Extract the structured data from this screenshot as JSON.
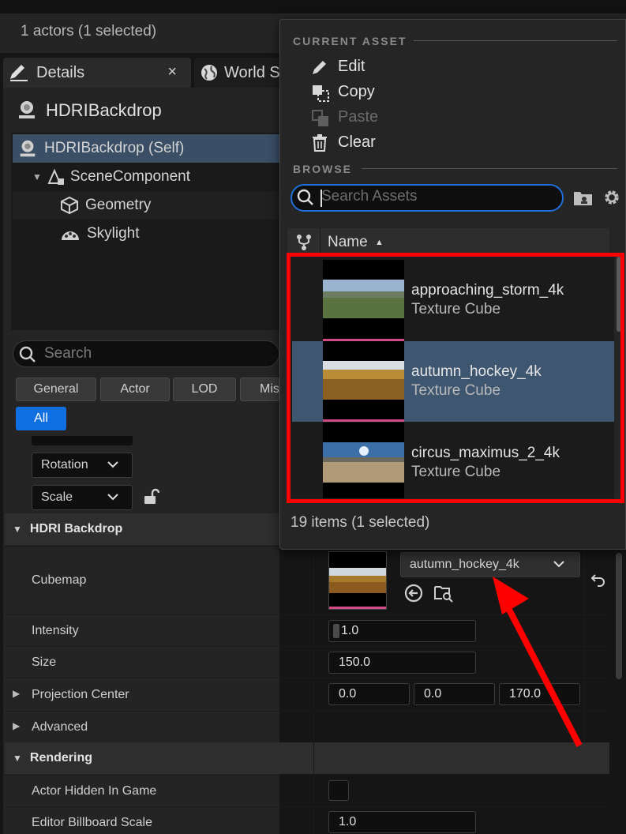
{
  "header": {
    "actors_status": "1 actors (1 selected)"
  },
  "tabs": [
    {
      "label": "Details",
      "close": "×"
    },
    {
      "label": "World S"
    }
  ],
  "actor": {
    "name": "HDRIBackdrop"
  },
  "components": [
    {
      "label": "HDRIBackdrop (Self)"
    },
    {
      "label": "SceneComponent"
    },
    {
      "label": "Geometry"
    },
    {
      "label": "Skylight"
    }
  ],
  "details_search": {
    "placeholder": "Search"
  },
  "filters": [
    "General",
    "Actor",
    "LOD",
    "Mis",
    "All"
  ],
  "transform": {
    "rotation_label": "Rotation",
    "scale_label": "Scale"
  },
  "sections": {
    "hdri_backdrop": "HDRI Backdrop",
    "rendering": "Rendering"
  },
  "properties": {
    "cubemap_label": "Cubemap",
    "cubemap_value": "autumn_hockey_4k",
    "intensity_label": "Intensity",
    "intensity_value": "1.0",
    "size_label": "Size",
    "size_value": "150.0",
    "projection_center_label": "Projection Center",
    "projection_center_values": [
      "0.0",
      "0.0",
      "170.0"
    ],
    "advanced_label": "Advanced",
    "actor_hidden_label": "Actor Hidden In Game",
    "billboard_scale_label": "Editor Billboard Scale",
    "billboard_scale_value": "1.0"
  },
  "popup": {
    "current_asset_header": "CURRENT ASSET",
    "edit": "Edit",
    "copy": "Copy",
    "paste": "Paste",
    "clear": "Clear",
    "browse_header": "BROWSE",
    "search_placeholder": "Search Assets",
    "column_name": "Name",
    "assets": [
      {
        "name": "approaching_storm_4k",
        "type": "Texture Cube",
        "selected": false
      },
      {
        "name": "autumn_hockey_4k",
        "type": "Texture Cube",
        "selected": true
      },
      {
        "name": "circus_maximus_2_4k",
        "type": "Texture Cube",
        "selected": false
      }
    ],
    "items_count": "19 items (1 selected)"
  },
  "colors": {
    "accent": "#0f6fe0",
    "selection": "#3f5670",
    "highlight": "#ff0000"
  }
}
